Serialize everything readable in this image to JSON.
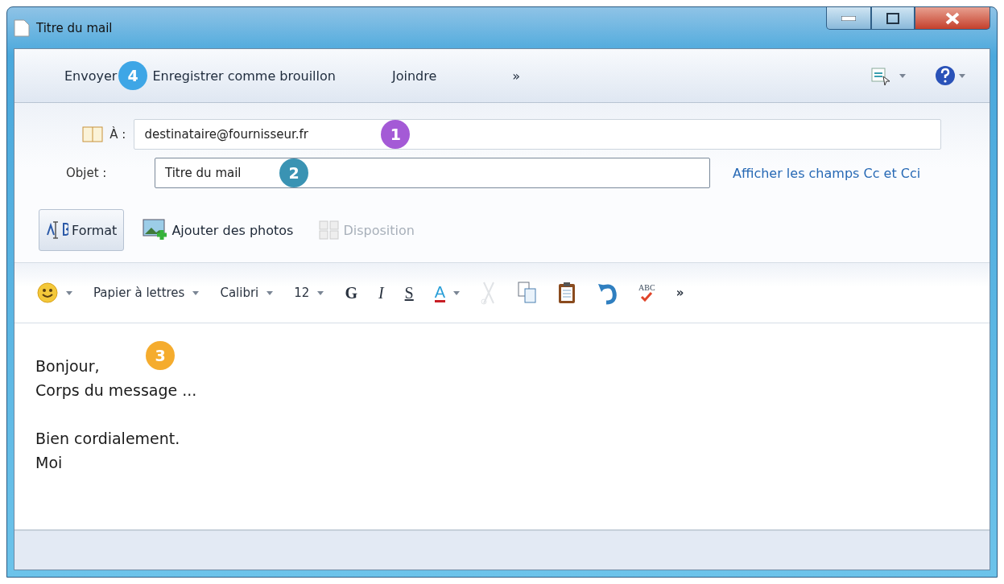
{
  "window": {
    "title": "Titre du mail"
  },
  "toolbar": {
    "items": [
      {
        "label": "Envoyer"
      },
      {
        "label": "Enregistrer comme brouillon"
      },
      {
        "label": "Joindre"
      },
      {
        "label": "»"
      }
    ],
    "callout": {
      "label": "4",
      "color": "#3ea6e6"
    }
  },
  "to_field": {
    "label": "À :",
    "value": "destinataire@fournisseur.fr",
    "callout": {
      "label": "1",
      "color": "#a45ad6"
    }
  },
  "subject_field": {
    "label": "Objet :",
    "value": "Titre du mail",
    "callout": {
      "label": "2",
      "color": "#3a93b3"
    }
  },
  "cc_link": "Afficher les champs Cc et Cci",
  "actions": [
    {
      "label": "Format",
      "selected": true,
      "disabled": false
    },
    {
      "label": "Ajouter des photos",
      "selected": false,
      "disabled": false
    },
    {
      "label": "Disposition",
      "selected": false,
      "disabled": true
    }
  ],
  "format_bar": [
    {
      "kind": "emoji"
    },
    {
      "kind": "dropdown",
      "label": "Papier à lettres"
    },
    {
      "kind": "dropdown",
      "label": "Calibri"
    },
    {
      "kind": "dropdown",
      "label": "12"
    },
    {
      "kind": "bold",
      "label": "G"
    },
    {
      "kind": "italic",
      "label": "I"
    },
    {
      "kind": "underline",
      "label": "S"
    },
    {
      "kind": "color",
      "label": "A"
    },
    {
      "kind": "cut",
      "disabled": true
    },
    {
      "kind": "copy",
      "disabled": false
    },
    {
      "kind": "paste",
      "disabled": false
    },
    {
      "kind": "undo",
      "disabled": false
    },
    {
      "kind": "spell",
      "label": "ABC"
    },
    {
      "kind": "more",
      "label": "»"
    }
  ],
  "body": {
    "paragraphs": [
      [
        "Bonjour,",
        "Corps du message ..."
      ],
      [
        "Bien cordialement.",
        "Moi"
      ]
    ],
    "callout": {
      "label": "3",
      "color": "#f5ac2e"
    }
  }
}
